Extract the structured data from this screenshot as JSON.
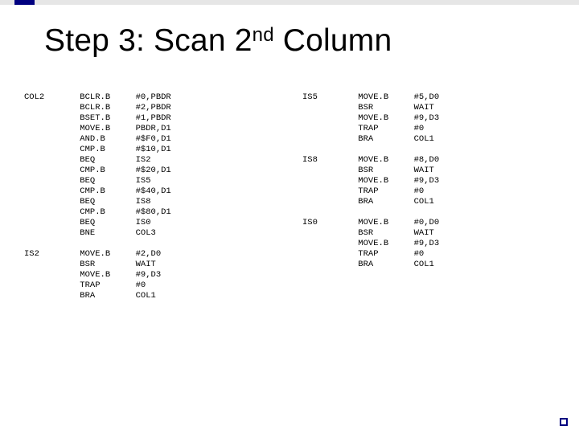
{
  "title_html": "Step 3: Scan 2<sup>nd</sup> Column",
  "left_block": "COL2       BCLR.B     #0,PBDR\n           BCLR.B     #2,PBDR\n           BSET.B     #1,PBDR\n           MOVE.B     PBDR,D1\n           AND.B      #$F0,D1\n           CMP.B      #$10,D1\n           BEQ        IS2\n           CMP.B      #$20,D1\n           BEQ        IS5\n           CMP.B      #$40,D1\n           BEQ        IS8\n           CMP.B      #$80,D1\n           BEQ        IS0\n           BNE        COL3\n\nIS2        MOVE.B     #2,D0\n           BSR        WAIT\n           MOVE.B     #9,D3\n           TRAP       #0\n           BRA        COL1",
  "right_block": "IS5        MOVE.B     #5,D0\n           BSR        WAIT\n           MOVE.B     #9,D3\n           TRAP       #0\n           BRA        COL1\n\nIS8        MOVE.B     #8,D0\n           BSR        WAIT\n           MOVE.B     #9,D3\n           TRAP       #0\n           BRA        COL1\n\nIS0        MOVE.B     #0,D0\n           BSR        WAIT\n           MOVE.B     #9,D3\n           TRAP       #0\n           BRA        COL1"
}
